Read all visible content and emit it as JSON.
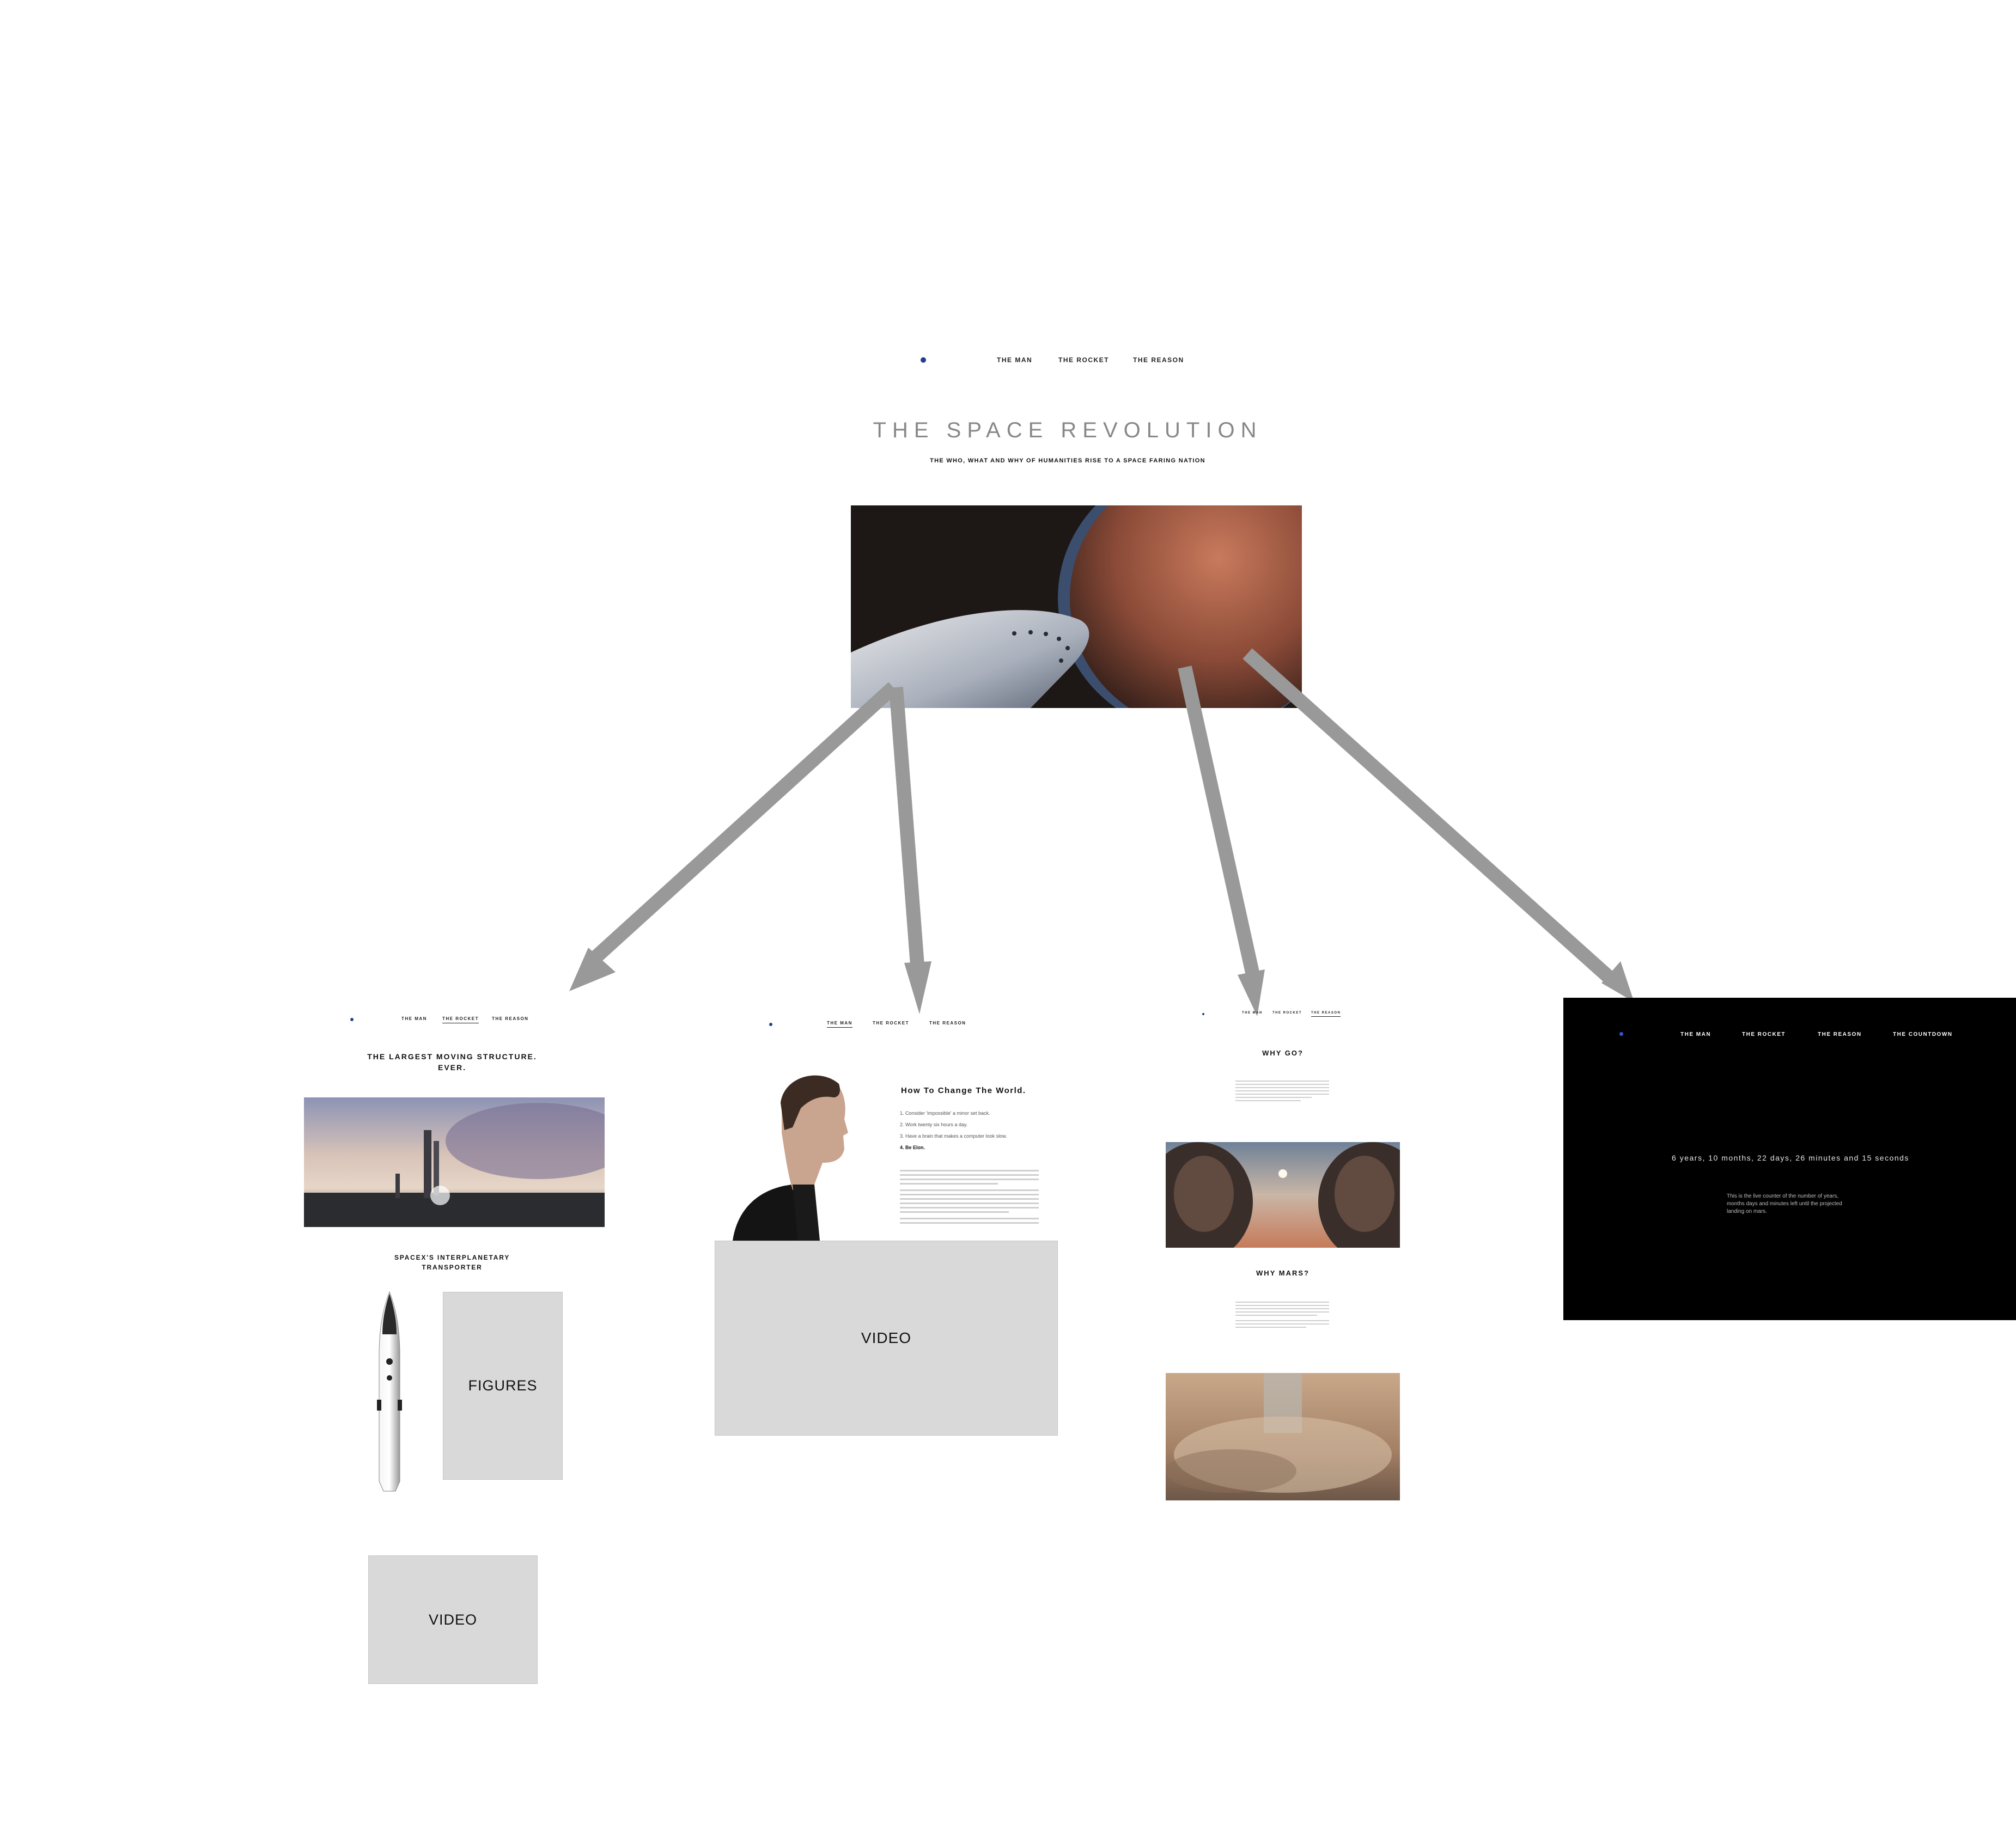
{
  "hero": {
    "nav": [
      "THE MAN",
      "THE ROCKET",
      "THE REASON"
    ],
    "title": "THE SPACE REVOLUTION",
    "subtitle": "THE WHO, WHAT AND WHY OF HUMANITIES RISE TO A SPACE FARING NATION"
  },
  "rocket_page": {
    "nav": [
      "THE MAN",
      "THE ROCKET",
      "THE REASON"
    ],
    "heading_line1": "THE LARGEST MOVING STRUCTURE.",
    "heading_line2": "EVER.",
    "sub_line1": "SPACEX'S INTERPLANETARY",
    "sub_line2": "TRANSPORTER",
    "figures_label": "FIGURES",
    "video_label": "VIDEO"
  },
  "man_page": {
    "nav": [
      "THE MAN",
      "THE ROCKET",
      "THE REASON"
    ],
    "heading": "How To Change The World.",
    "list": [
      "1. Consider 'impossible' a minor set back.",
      "2. Work twenty six hours a day.",
      "3. Have a brain that makes a computer look slow.",
      "4. Be Elon."
    ],
    "video_label": "VIDEO"
  },
  "reason_page": {
    "nav": [
      "THE MAN",
      "THE ROCKET",
      "THE REASON"
    ],
    "heading1": "WHY GO?",
    "heading2": "WHY MARS?"
  },
  "countdown_page": {
    "nav": [
      "THE MAN",
      "THE ROCKET",
      "THE REASON",
      "THE COUNTDOWN"
    ],
    "countdown": "6 years, 10 months, 22 days, 26 minutes and 15 seconds",
    "caption_line1": "This is the live counter of the number of years,",
    "caption_line2": "months days and minutes left until the projected",
    "caption_line3": "landing on mars."
  },
  "colors": {
    "accent_dot": "#1f3f8f",
    "arrow": "#999999",
    "placeholder": "#d9d9d9",
    "dark_bg": "#000000"
  }
}
